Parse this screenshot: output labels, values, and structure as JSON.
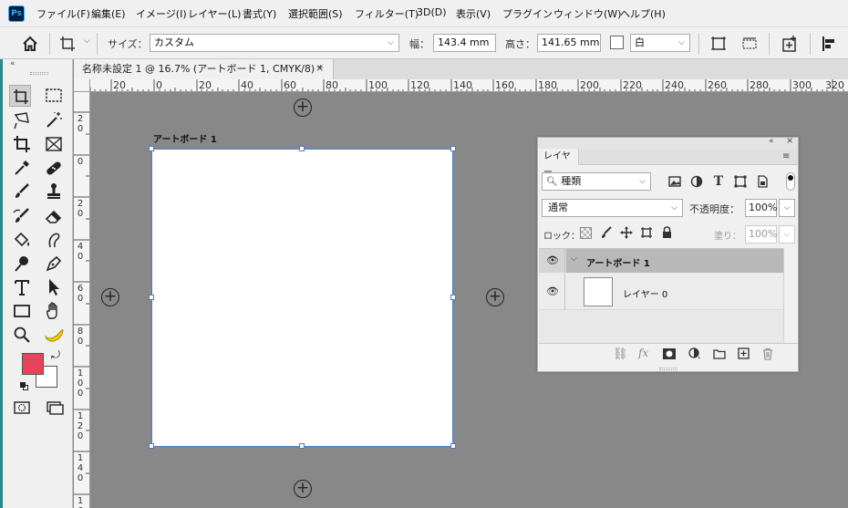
{
  "app": {
    "logo": "Ps"
  },
  "menu": [
    "ファイル(F)",
    "編集(E)",
    "イメージ(I)",
    "レイヤー(L)",
    "書式(Y)",
    "選択範囲(S)",
    "フィルター(T)",
    "3D(D)",
    "表示(V)",
    "プラグイン",
    "ウィンドウ(W)",
    "ヘルプ(H)"
  ],
  "options": {
    "size_label": "サイズ：",
    "size_value": "カスタム",
    "width_label": "幅：",
    "width_value": "143.4 mm",
    "height_label": "高さ：",
    "height_value": "141.65 mm",
    "bg_value": "白"
  },
  "document": {
    "tab_title": "名称未設定 1 @ 16.7% (アートボード 1, CMYK/8) *",
    "close_glyph": "×",
    "artboard_name": "アートボード 1"
  },
  "rulers": {
    "horizontal": [
      "20",
      "0",
      "20",
      "40",
      "60",
      "80",
      "100",
      "120",
      "140",
      "160",
      "180",
      "200",
      "220",
      "240",
      "260",
      "280",
      "300",
      "320"
    ],
    "vertical": [
      "2\n0",
      "0",
      "2\n0",
      "4\n0",
      "6\n0",
      "8\n0",
      "1\n0\n0",
      "1\n2\n0",
      "1\n4\n0",
      "1\n6"
    ]
  },
  "layers_panel": {
    "tab": "レイヤー",
    "filter_value": "種類",
    "blend_mode": "通常",
    "opacity_label": "不透明度：",
    "opacity_value": "100%",
    "lock_label": "ロック：",
    "fill_label": "塗り：",
    "fill_value": "100%",
    "layers": [
      {
        "name": "アートボード 1",
        "type": "artboard",
        "visible": true
      },
      {
        "name": "レイヤー 0",
        "type": "layer",
        "visible": true
      }
    ]
  },
  "colors": {
    "foreground": "#e8435a",
    "background": "#ffffff",
    "canvas": "#888888",
    "selection": "#4a7ec9"
  },
  "icons": {
    "toolbar": [
      "artboard-tool-icon",
      "marquee-icon",
      "lasso-icon",
      "magic-wand-icon",
      "crop-icon",
      "frame-icon",
      "eyedropper-icon",
      "healing-brush-icon",
      "brush-icon",
      "clone-stamp-icon",
      "history-brush-icon",
      "eraser-icon",
      "paint-bucket-icon",
      "smudge-icon",
      "dodge-icon",
      "pen-icon",
      "type-icon",
      "path-selection-icon",
      "rectangle-icon",
      "hand-icon",
      "zoom-icon",
      "banana-icon"
    ]
  }
}
